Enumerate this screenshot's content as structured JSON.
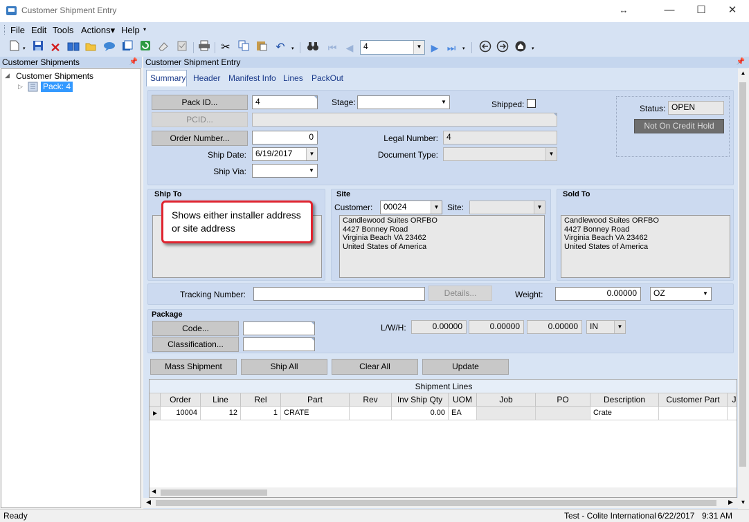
{
  "window": {
    "title": "Customer Shipment Entry",
    "resize_glyph": "↔",
    "minimize": "—",
    "maximize": "☐",
    "close": "✕"
  },
  "menu": [
    "File",
    "Edit",
    "Tools",
    "Actions▾",
    "Help"
  ],
  "toolbar": {
    "record_value": "4",
    "icons": [
      "new-icon",
      "save-icon",
      "delete-icon",
      "book-icon",
      "folder-icon",
      "comment-icon",
      "attach-icon",
      "refresh-icon",
      "clear-icon",
      "clipboard-icon",
      "print-icon",
      "cut-icon",
      "copy-icon",
      "paste-icon",
      "undo-icon",
      "binoculars-icon",
      "first-record-icon",
      "prev-record-icon",
      "next-record-icon",
      "last-record-icon",
      "back-icon",
      "forward-icon",
      "home-icon"
    ]
  },
  "tree_panel": {
    "title": "Customer Shipments",
    "root": "Customer Shipments",
    "child": "Pack: 4"
  },
  "content_panel": {
    "title": "Customer Shipment Entry"
  },
  "tabs": [
    "Summary",
    "Header",
    "Manifest Info",
    "Lines",
    "PackOut"
  ],
  "header_form": {
    "pack_id_button": "Pack ID...",
    "pack_id_value": "4",
    "pcid_button": "PCID...",
    "order_button": "Order Number...",
    "order_value": "0",
    "ship_date_label": "Ship Date:",
    "ship_date_value": "6/19/2017",
    "ship_via_label": "Ship Via:",
    "ship_via_value": "",
    "stage_label": "Stage:",
    "stage_value": "",
    "shipped_label": "Shipped:",
    "legal_number_label": "Legal Number:",
    "legal_number_value": "4",
    "document_type_label": "Document Type:",
    "document_type_value": "",
    "status_label": "Status:",
    "status_value": "OPEN",
    "credit_hold": "Not On Credit Hold"
  },
  "ship_to": {
    "title": "Ship To",
    "callout": "Shows either installer address or site address"
  },
  "site": {
    "title": "Site",
    "customer_label": "Customer:",
    "customer_value": "00024",
    "site_label": "Site:",
    "site_value": "",
    "address": [
      "Candlewood Suites ORFBO",
      "4427 Bonney Road",
      "Virginia Beach VA 23462",
      "United States of America"
    ]
  },
  "sold_to": {
    "title": "Sold To",
    "address": [
      "Candlewood Suites ORFBO",
      "4427 Bonney Road",
      "Virginia Beach VA 23462",
      "United States of America"
    ]
  },
  "tracking": {
    "label": "Tracking Number:",
    "value": "",
    "details_button": "Details...",
    "weight_label": "Weight:",
    "weight_value": "0.00000",
    "weight_uom": "OZ"
  },
  "package": {
    "title": "Package",
    "code_button": "Code...",
    "classification_button": "Classification...",
    "lwh_label": "L/W/H:",
    "length": "0.00000",
    "width": "0.00000",
    "height": "0.00000",
    "dim_uom": "IN"
  },
  "actions": [
    "Mass Shipment",
    "Ship All",
    "Clear All",
    "Update"
  ],
  "shipment_lines": {
    "caption": "Shipment Lines",
    "columns": [
      "Order",
      "Line",
      "Rel",
      "Part",
      "Rev",
      "Inv Ship Qty",
      "UOM",
      "Job",
      "PO",
      "Description",
      "Customer Part",
      "J"
    ],
    "rows": [
      [
        "10004",
        "12",
        "1",
        "CRATE",
        "",
        "0.00",
        "EA",
        "",
        "",
        "Crate",
        "",
        ""
      ]
    ]
  },
  "status_bar": {
    "left": "Ready",
    "company": "Test - Colite International",
    "date": "6/22/2017",
    "time": "9:31 AM"
  }
}
